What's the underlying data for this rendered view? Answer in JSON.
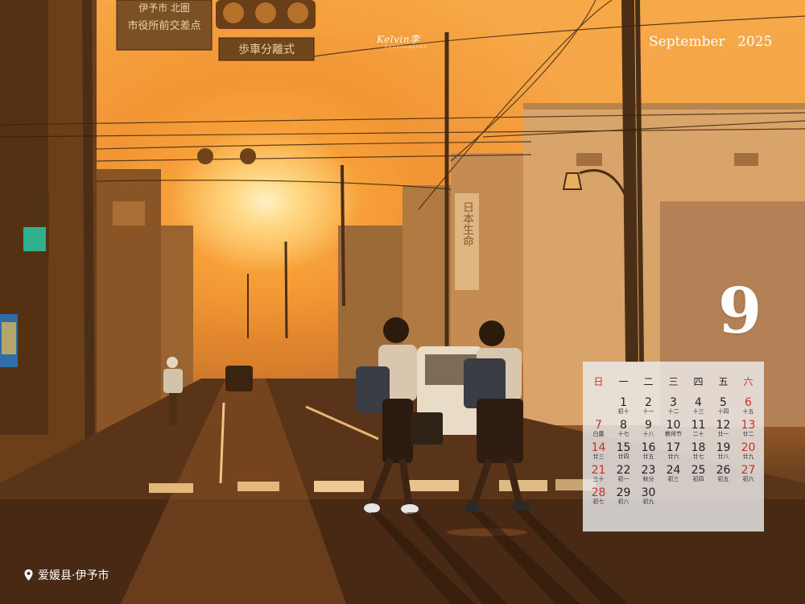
{
  "brand": {
    "name": "Kelvin李",
    "sub": "PHOTOGRAPHY"
  },
  "header": {
    "month_name": "September",
    "year": "2025"
  },
  "month_number": "9",
  "calendar": {
    "weekdays": [
      {
        "label": "日",
        "red": true
      },
      {
        "label": "一",
        "red": false
      },
      {
        "label": "二",
        "red": false
      },
      {
        "label": "三",
        "red": false
      },
      {
        "label": "四",
        "red": false
      },
      {
        "label": "五",
        "red": false
      },
      {
        "label": "六",
        "red": true
      }
    ],
    "days": [
      {
        "day": "",
        "lunar": ""
      },
      {
        "day": "1",
        "lunar": "初十"
      },
      {
        "day": "2",
        "lunar": "十一"
      },
      {
        "day": "3",
        "lunar": "十二"
      },
      {
        "day": "4",
        "lunar": "十三"
      },
      {
        "day": "5",
        "lunar": "十四"
      },
      {
        "day": "6",
        "lunar": "十五"
      },
      {
        "day": "7",
        "lunar": "白露"
      },
      {
        "day": "8",
        "lunar": "十七"
      },
      {
        "day": "9",
        "lunar": "十八"
      },
      {
        "day": "10",
        "lunar": "教师节"
      },
      {
        "day": "11",
        "lunar": "二十"
      },
      {
        "day": "12",
        "lunar": "廿一"
      },
      {
        "day": "13",
        "lunar": "廿二"
      },
      {
        "day": "14",
        "lunar": "廿三"
      },
      {
        "day": "15",
        "lunar": "廿四"
      },
      {
        "day": "16",
        "lunar": "廿五"
      },
      {
        "day": "17",
        "lunar": "廿六"
      },
      {
        "day": "18",
        "lunar": "廿七"
      },
      {
        "day": "19",
        "lunar": "廿八"
      },
      {
        "day": "20",
        "lunar": "廿九"
      },
      {
        "day": "21",
        "lunar": "三十"
      },
      {
        "day": "22",
        "lunar": "初一"
      },
      {
        "day": "23",
        "lunar": "秋分"
      },
      {
        "day": "24",
        "lunar": "初三"
      },
      {
        "day": "25",
        "lunar": "初四"
      },
      {
        "day": "26",
        "lunar": "初五"
      },
      {
        "day": "27",
        "lunar": "初六"
      },
      {
        "day": "28",
        "lunar": "初七"
      },
      {
        "day": "29",
        "lunar": "初八"
      },
      {
        "day": "30",
        "lunar": "初九"
      }
    ]
  },
  "location": {
    "icon": "location-pin-icon",
    "text": "爱媛县·伊予市"
  },
  "photo": {
    "signs": {
      "top_sign_line1": "伊予市 北圏",
      "top_sign_line2": "市役所前交差点",
      "lower_sign": "歩車分離式",
      "building_sign": "日本生命"
    }
  },
  "colors": {
    "holiday_red": "#c8322a",
    "sunset_orange": "#f4a146"
  }
}
